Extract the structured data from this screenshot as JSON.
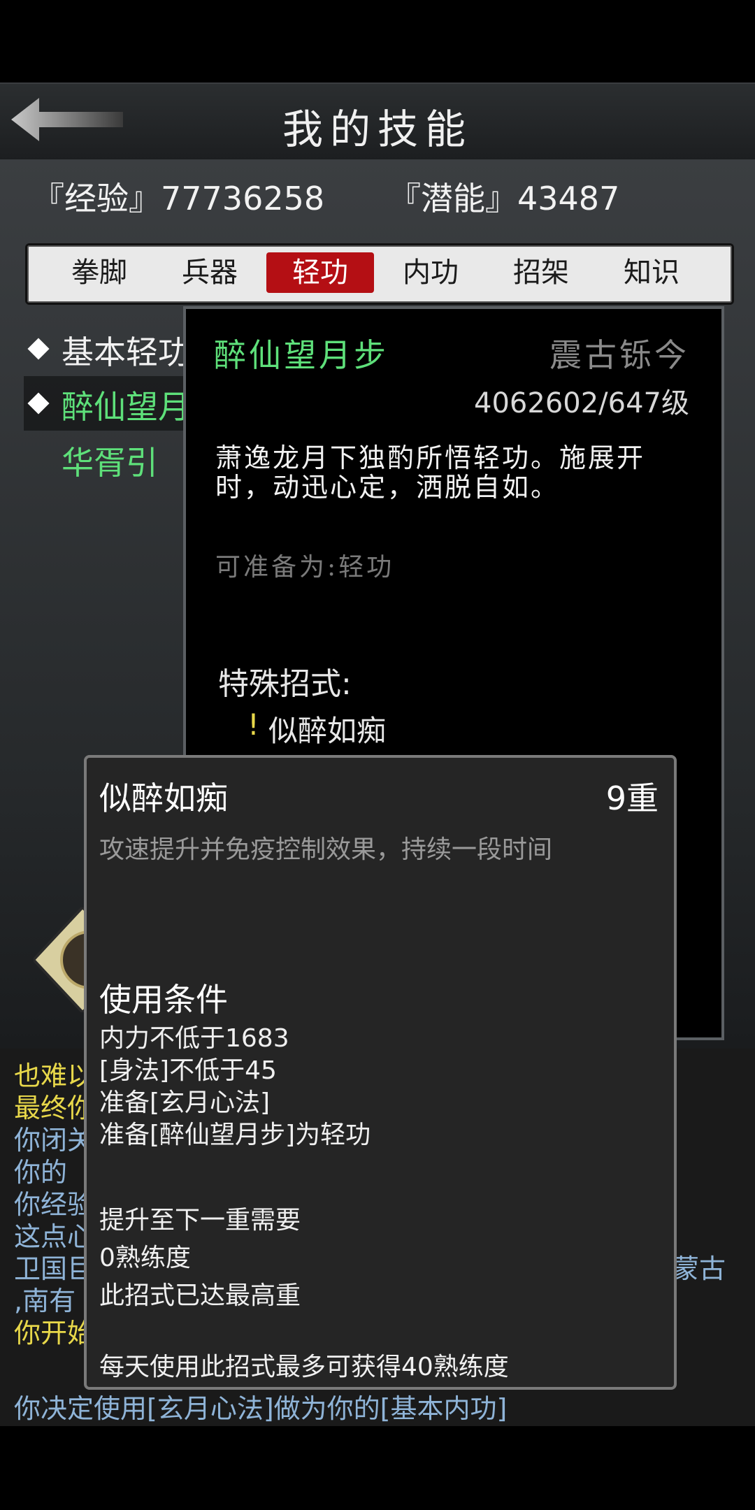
{
  "header": {
    "title": "我的技能"
  },
  "stats": {
    "exp": "『经验』77736258",
    "potential": "『潜能』43487"
  },
  "tabs": [
    {
      "label": "拳脚"
    },
    {
      "label": "兵器"
    },
    {
      "label": "轻功"
    },
    {
      "label": "内功"
    },
    {
      "label": "招架"
    },
    {
      "label": "知识"
    }
  ],
  "skills": [
    {
      "label": "基本轻功"
    },
    {
      "label": "醉仙望月步"
    },
    {
      "label": "华胥引"
    }
  ],
  "detail": {
    "name": "醉仙望月步",
    "rank": "震古铄今",
    "level": "4062602/647级",
    "description": "萧逸龙月下独酌所悟轻功。施展开时，动迅心定，洒脱自如。",
    "prepare": "可准备为:轻功",
    "special_title": "特殊招式:",
    "special_mark": "!",
    "special_move": "似醉如痴"
  },
  "popup": {
    "name": "似醉如痴",
    "level": "9重",
    "desc": "攻速提升并免疫控制效果，持续一段时间",
    "cond_title": "使用条件",
    "conditions": [
      "内力不低于1683",
      "[身法]不低于45",
      "准备[玄月心法]",
      "准备[醉仙望月步]为轻功"
    ],
    "next_title": "提升至下一重需要",
    "next_value": "0熟练度",
    "max_note": "此招式已达最高重",
    "daily_note": "每天使用此招式最多可获得40熟练度"
  },
  "log": {
    "lines": [
      "也难以",
      "最终你",
      "你闭关",
      "你的",
      "你经验",
      "这点心",
      "卫国巨",
      ",南有",
      "你开始"
    ],
    "right_fragment": "蒙古",
    "last_line": "你决定使用[玄月心法]做为你的[基本内功]"
  },
  "colors": {
    "accent_green": "#5ee07a",
    "tab_active": "#b40f14",
    "log_yellow": "#e8d84a",
    "log_blue": "#8fb4d8"
  }
}
